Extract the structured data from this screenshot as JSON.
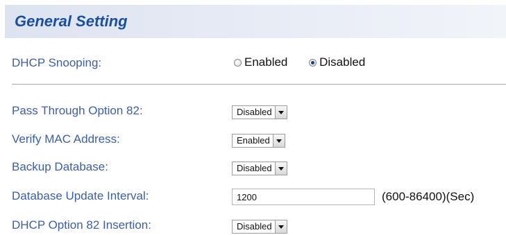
{
  "header": {
    "title": "General Setting"
  },
  "dhcp_snooping": {
    "label": "DHCP Snooping:",
    "options": [
      {
        "label": "Enabled",
        "checked": false
      },
      {
        "label": "Disabled",
        "checked": true
      }
    ]
  },
  "pass_through_option82": {
    "label": "Pass Through Option 82:",
    "value": "Disabled"
  },
  "verify_mac": {
    "label": "Verify MAC Address:",
    "value": "Enabled"
  },
  "backup_database": {
    "label": "Backup Database:",
    "value": "Disabled"
  },
  "update_interval": {
    "label": "Database Update Interval:",
    "value": "1200",
    "unit": "(600-86400)(Sec)"
  },
  "option82_insertion": {
    "label": "DHCP Option 82 Insertion:",
    "value": "Disabled"
  }
}
